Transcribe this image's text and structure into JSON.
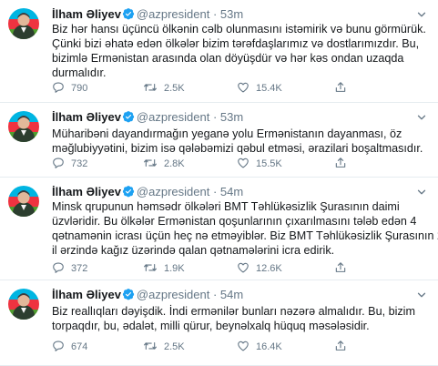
{
  "tweets": [
    {
      "name": "İlham Əliyev",
      "handle": "@azpresident",
      "dot": "·",
      "time": "53m",
      "lines": [
        "Biz hər hansı üçüncü ölkənin cəlb olunmasını istəmirik və bunu görmürük.",
        "Çünki bizi əhatə edən ölkələr bizim tərəfdaşlarımız və dostlarımızdır. Bu,",
        "bizimlə Ermənistan arasında olan döyüşdür və hər kəs ondan uzaqda",
        "durmalıdır."
      ],
      "replies": "790",
      "retweets": "2.5K",
      "likes": "15.4K"
    },
    {
      "name": "İlham Əliyev",
      "handle": "@azpresident",
      "dot": "·",
      "time": "53m",
      "lines": [
        "Müharibəni dayandırmağın yeganə yolu Ermənistanın dayanması, öz",
        "məğlubiyyətini, bizim isə qələbəmizi qəbul etməsi, ərazilari boşaltmasıdır."
      ],
      "replies": "732",
      "retweets": "2.8K",
      "likes": "15.5K"
    },
    {
      "name": "İlham Əliyev",
      "handle": "@azpresident",
      "dot": "·",
      "time": "54m",
      "lines": [
        "Minsk qrupunun həmsədr ölkələri BMT Təhlükəsizlik Şurasının daimi",
        "üzvləridir. Bu ölkələr Ermənistan qoşunlarının çıxarılmasını tələb edən 4",
        "qətnamənin icrası üçün heç nə etməyiblər. Biz BMT Təhlükəsizlik Şurasının 27",
        "il ərzində kağız üzərində qalan qətnamələrini icra edirik."
      ],
      "replies": "372",
      "retweets": "1.9K",
      "likes": "12.6K"
    },
    {
      "name": "İlham Əliyev",
      "handle": "@azpresident",
      "dot": "·",
      "time": "54m",
      "lines": [
        "Biz reallıqları dəyişdik. İndi ermənilər bunları nəzərə almalıdır. Bu, bizim",
        "torpaqdır, bu, ədalət, milli qürur, beynəlxalq hüquq məsələsidir."
      ],
      "replies": "674",
      "retweets": "2.5K",
      "likes": "16.4K"
    }
  ],
  "colors": {
    "name": "#14171a",
    "muted": "#657786",
    "verified": "#1da1f2",
    "divider": "#e6ecf0",
    "flag_blue": "#00b5e2",
    "flag_red": "#ef3340",
    "flag_green": "#509e2f"
  },
  "icons": {
    "verified": "verified-badge-icon",
    "caret": "chevron-down-icon",
    "reply": "reply-icon",
    "retweet": "retweet-icon",
    "like": "heart-icon",
    "share": "share-icon"
  }
}
